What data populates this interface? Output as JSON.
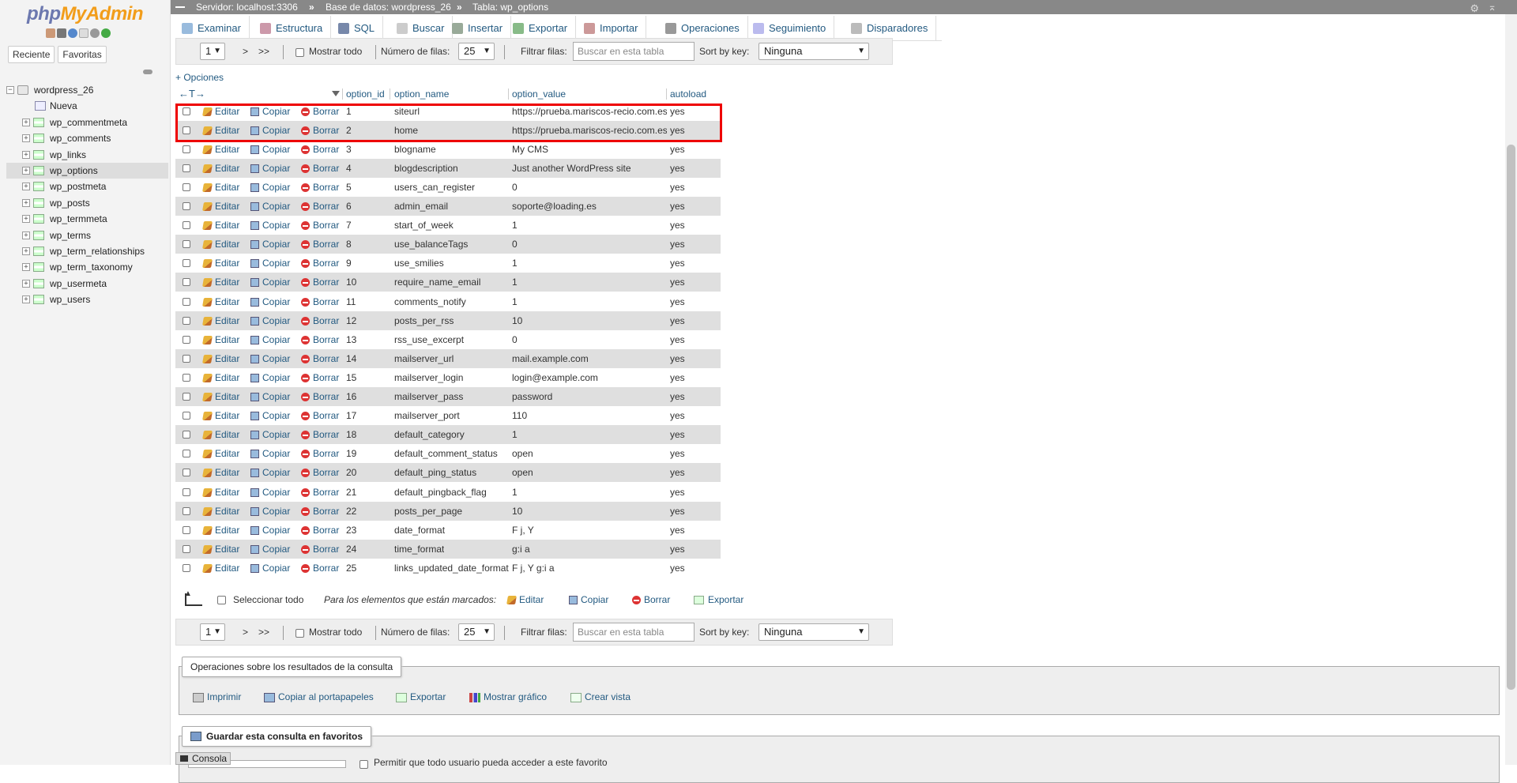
{
  "app": {
    "logo_php": "php",
    "logo_myadmin": "MyAdmin",
    "nav_tabs": [
      "Reciente",
      "Favoritas"
    ]
  },
  "breadcrumb": {
    "server": "Servidor: localhost:3306",
    "database": "Base de datos: wordpress_26",
    "table": "Tabla: wp_options",
    "separator": "»"
  },
  "tree": {
    "database": "wordpress_26",
    "new_label": "Nueva",
    "tables": [
      "wp_commentmeta",
      "wp_comments",
      "wp_links",
      "wp_options",
      "wp_postmeta",
      "wp_posts",
      "wp_termmeta",
      "wp_terms",
      "wp_term_relationships",
      "wp_term_taxonomy",
      "wp_usermeta",
      "wp_users"
    ],
    "active_table": "wp_options"
  },
  "menu": {
    "tabs": [
      {
        "label": "Examinar",
        "icon": "browse-icon"
      },
      {
        "label": "Estructura",
        "icon": "structure-icon"
      },
      {
        "label": "SQL",
        "icon": "sql-icon"
      },
      {
        "label": "Buscar",
        "icon": "search-icon"
      },
      {
        "label": "Insertar",
        "icon": "insert-icon"
      },
      {
        "label": "Exportar",
        "icon": "export-icon"
      },
      {
        "label": "Importar",
        "icon": "import-icon"
      },
      {
        "label": "Operaciones",
        "icon": "operations-icon"
      },
      {
        "label": "Seguimiento",
        "icon": "tracking-icon"
      },
      {
        "label": "Disparadores",
        "icon": "triggers-icon"
      }
    ]
  },
  "navbar": {
    "page_value": "1",
    "next": ">",
    "last": ">>",
    "show_all": "Mostrar todo",
    "rows_label": "Número de filas:",
    "rows_value": "25",
    "filter_label": "Filtrar filas:",
    "filter_placeholder": "Buscar en esta tabla",
    "sort_label": "Sort by key:",
    "sort_value": "Ninguna"
  },
  "options_link": "+ Opciones",
  "table": {
    "arrows": "←T→",
    "columns": [
      "option_id",
      "option_name",
      "option_value",
      "autoload"
    ],
    "actions": {
      "edit": "Editar",
      "copy": "Copiar",
      "delete": "Borrar"
    },
    "rows": [
      {
        "id": "1",
        "name": "siteurl",
        "value": "https://prueba.mariscos-recio.com.es",
        "autoload": "yes"
      },
      {
        "id": "2",
        "name": "home",
        "value": "https://prueba.mariscos-recio.com.es",
        "autoload": "yes"
      },
      {
        "id": "3",
        "name": "blogname",
        "value": "My CMS",
        "autoload": "yes"
      },
      {
        "id": "4",
        "name": "blogdescription",
        "value": "Just another WordPress site",
        "autoload": "yes"
      },
      {
        "id": "5",
        "name": "users_can_register",
        "value": "0",
        "autoload": "yes"
      },
      {
        "id": "6",
        "name": "admin_email",
        "value": "soporte@loading.es",
        "autoload": "yes"
      },
      {
        "id": "7",
        "name": "start_of_week",
        "value": "1",
        "autoload": "yes"
      },
      {
        "id": "8",
        "name": "use_balanceTags",
        "value": "0",
        "autoload": "yes"
      },
      {
        "id": "9",
        "name": "use_smilies",
        "value": "1",
        "autoload": "yes"
      },
      {
        "id": "10",
        "name": "require_name_email",
        "value": "1",
        "autoload": "yes"
      },
      {
        "id": "11",
        "name": "comments_notify",
        "value": "1",
        "autoload": "yes"
      },
      {
        "id": "12",
        "name": "posts_per_rss",
        "value": "10",
        "autoload": "yes"
      },
      {
        "id": "13",
        "name": "rss_use_excerpt",
        "value": "0",
        "autoload": "yes"
      },
      {
        "id": "14",
        "name": "mailserver_url",
        "value": "mail.example.com",
        "autoload": "yes"
      },
      {
        "id": "15",
        "name": "mailserver_login",
        "value": "login@example.com",
        "autoload": "yes"
      },
      {
        "id": "16",
        "name": "mailserver_pass",
        "value": "password",
        "autoload": "yes"
      },
      {
        "id": "17",
        "name": "mailserver_port",
        "value": "110",
        "autoload": "yes"
      },
      {
        "id": "18",
        "name": "default_category",
        "value": "1",
        "autoload": "yes"
      },
      {
        "id": "19",
        "name": "default_comment_status",
        "value": "open",
        "autoload": "yes"
      },
      {
        "id": "20",
        "name": "default_ping_status",
        "value": "open",
        "autoload": "yes"
      },
      {
        "id": "21",
        "name": "default_pingback_flag",
        "value": "1",
        "autoload": "yes"
      },
      {
        "id": "22",
        "name": "posts_per_page",
        "value": "10",
        "autoload": "yes"
      },
      {
        "id": "23",
        "name": "date_format",
        "value": "F j, Y",
        "autoload": "yes"
      },
      {
        "id": "24",
        "name": "time_format",
        "value": "g:i a",
        "autoload": "yes"
      },
      {
        "id": "25",
        "name": "links_updated_date_format",
        "value": "F j, Y g:i a",
        "autoload": "yes"
      }
    ]
  },
  "multi": {
    "select_all": "Seleccionar todo",
    "marked_label": "Para los elementos que están marcados:",
    "edit": "Editar",
    "copy": "Copiar",
    "delete": "Borrar",
    "export": "Exportar"
  },
  "ops": {
    "legend": "Operaciones sobre los resultados de la consulta",
    "links": [
      "Imprimir",
      "Copiar al portapapeles",
      "Exportar",
      "Mostrar gráfico",
      "Crear vista"
    ]
  },
  "bookmark": {
    "legend": "Guardar esta consulta en favoritos",
    "permission": "Permitir que todo usuario pueda acceder a este favorito"
  },
  "console": "Consola",
  "colors": {
    "link": "#235a81",
    "highlight": "#e00000",
    "logo_php": "#6c78af",
    "logo_myadmin": "#f29d1a"
  }
}
